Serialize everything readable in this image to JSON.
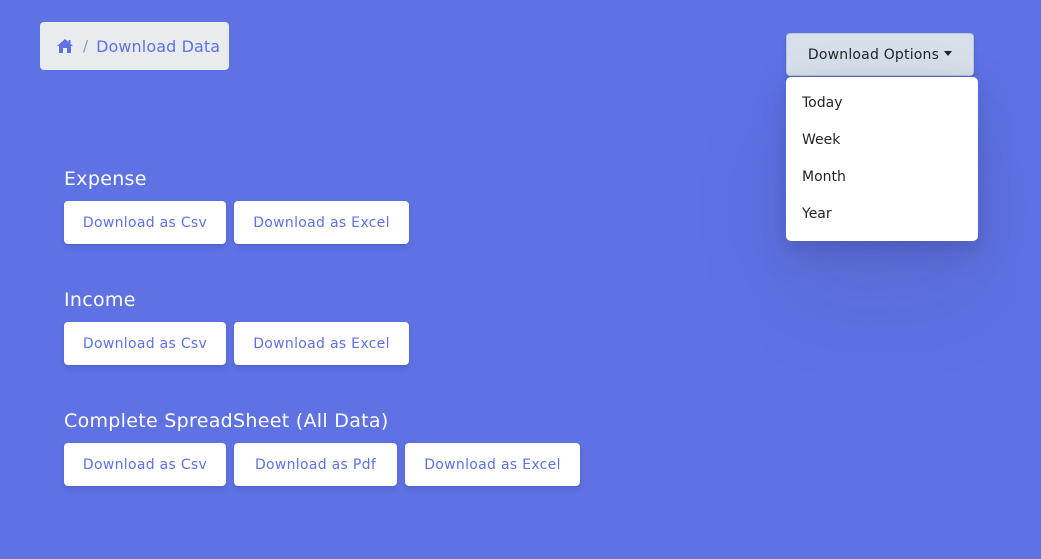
{
  "breadcrumb": {
    "home_icon": "home-icon",
    "separator": "/",
    "current": "Download Data"
  },
  "dropdown": {
    "toggle_label": "Download Options",
    "items": [
      "Today",
      "Week",
      "Month",
      "Year"
    ]
  },
  "sections": [
    {
      "title": "Expense",
      "buttons": [
        "Download as Csv",
        "Download as Excel"
      ]
    },
    {
      "title": "Income",
      "buttons": [
        "Download as Csv",
        "Download as Excel"
      ]
    },
    {
      "title": "Complete SpreadSheet (All Data)",
      "buttons": [
        "Download as Csv",
        "Download as Pdf",
        "Download as Excel"
      ]
    }
  ],
  "colors": {
    "background": "#5e72e4",
    "accent": "#5e72e4",
    "button_bg": "#ffffff"
  }
}
